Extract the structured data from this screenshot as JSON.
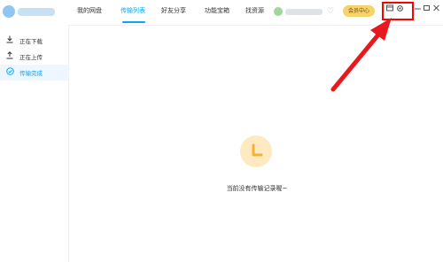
{
  "titlebar": {
    "tabs": [
      {
        "label": "我的网盘"
      },
      {
        "label": "传输列表"
      },
      {
        "label": "好友分享"
      },
      {
        "label": "功能宝箱"
      },
      {
        "label": "找资源"
      }
    ],
    "active_tab": "传输列表",
    "vip_label": "会员中心"
  },
  "sidebar": {
    "items": [
      {
        "label": "正在下载"
      },
      {
        "label": "正在上传"
      },
      {
        "label": "传输完成"
      }
    ],
    "active_item": "传输完成"
  },
  "main": {
    "empty_message": "当前没有传输记录喔~"
  },
  "icons": {
    "app_logo": "cloud-logo-icon",
    "settings": "gear-icon",
    "skin": "skin-icon",
    "diamond": "diamond-icon",
    "download": "download-icon",
    "upload": "upload-icon",
    "completed": "check-circle-icon",
    "empty_state": "clock-icon"
  },
  "colors": {
    "accent": "#06a7ff",
    "vip": "#f7d36b",
    "annotation": "#ff0000",
    "empty_icon_bg": "#fdeac1",
    "empty_icon_fg": "#f6b333"
  }
}
